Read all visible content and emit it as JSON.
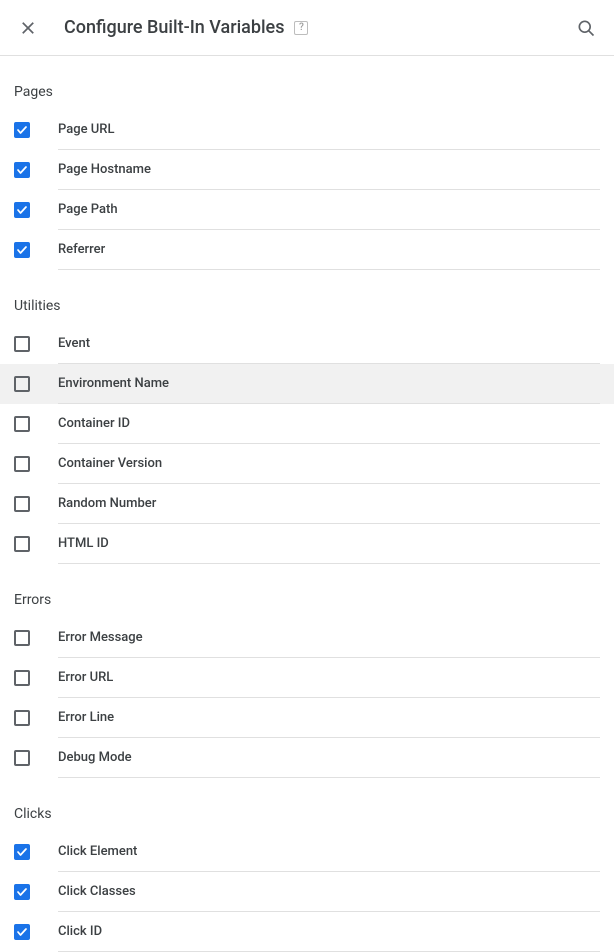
{
  "header": {
    "title": "Configure Built-In Variables"
  },
  "sections": [
    {
      "heading": "Pages",
      "items": [
        {
          "label": "Page URL",
          "checked": true,
          "highlight": false
        },
        {
          "label": "Page Hostname",
          "checked": true,
          "highlight": false
        },
        {
          "label": "Page Path",
          "checked": true,
          "highlight": false
        },
        {
          "label": "Referrer",
          "checked": true,
          "highlight": false
        }
      ]
    },
    {
      "heading": "Utilities",
      "items": [
        {
          "label": "Event",
          "checked": false,
          "highlight": false
        },
        {
          "label": "Environment Name",
          "checked": false,
          "highlight": true
        },
        {
          "label": "Container ID",
          "checked": false,
          "highlight": false
        },
        {
          "label": "Container Version",
          "checked": false,
          "highlight": false
        },
        {
          "label": "Random Number",
          "checked": false,
          "highlight": false
        },
        {
          "label": "HTML ID",
          "checked": false,
          "highlight": false
        }
      ]
    },
    {
      "heading": "Errors",
      "items": [
        {
          "label": "Error Message",
          "checked": false,
          "highlight": false
        },
        {
          "label": "Error URL",
          "checked": false,
          "highlight": false
        },
        {
          "label": "Error Line",
          "checked": false,
          "highlight": false
        },
        {
          "label": "Debug Mode",
          "checked": false,
          "highlight": false
        }
      ]
    },
    {
      "heading": "Clicks",
      "items": [
        {
          "label": "Click Element",
          "checked": true,
          "highlight": false
        },
        {
          "label": "Click Classes",
          "checked": true,
          "highlight": false
        },
        {
          "label": "Click ID",
          "checked": true,
          "highlight": false
        }
      ]
    }
  ]
}
